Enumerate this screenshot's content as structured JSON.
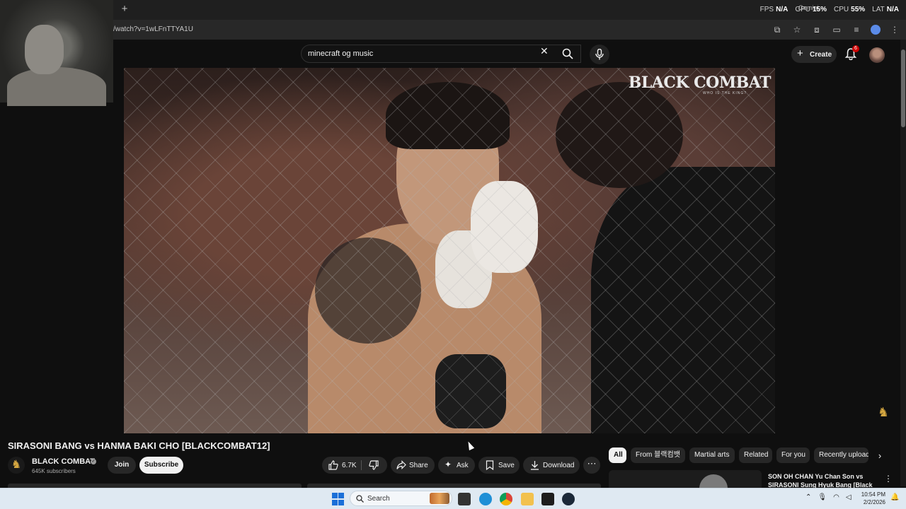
{
  "browser": {
    "url": "/watch?v=1wLFnTTYA1U",
    "new_tab_symbol": "+",
    "gemini_label": "Gemini",
    "perf": {
      "fps_label": "FPS",
      "fps_value": "N/A",
      "gpu_label": "GPU",
      "gpu_value": "15%",
      "cpu_label": "CPU",
      "cpu_value": "55%",
      "lat_label": "LAT",
      "lat_value": "N/A"
    }
  },
  "masthead": {
    "search_query": "minecraft og music",
    "create_label": "Create",
    "notification_count": "6"
  },
  "video": {
    "watermark": "BLACK COMBAT",
    "watermark_sub": "WHO IS THE KING?"
  },
  "watch": {
    "title": "SIRASONI BANG vs HANMA BAKI CHO [BLACKCOMBAT12]",
    "channel_name": "BLACK COMBAT",
    "subscribers": "645K subscribers",
    "join_label": "Join",
    "subscribe_label": "Subscribe",
    "like_count": "6.7K",
    "share_label": "Share",
    "ask_label": "Ask",
    "save_label": "Save",
    "download_label": "Download"
  },
  "chips": [
    "All",
    "From 블랙컴뱃",
    "Martial arts",
    "Related",
    "For you",
    "Recently uploaded"
  ],
  "recommendation": {
    "title": "SON OH CHAN Yu Chan Son vs SIRASONI Sung Hyuk Bang [Black"
  },
  "taskbar": {
    "search_label": "Search",
    "time": "10:54 PM",
    "date": "2/2/2026"
  },
  "colors": {
    "background": "#0f0f0f",
    "notification_badge": "#cc0000",
    "subscribe_bg": "#f1f1f1",
    "taskbar": "#dfe9f2"
  }
}
